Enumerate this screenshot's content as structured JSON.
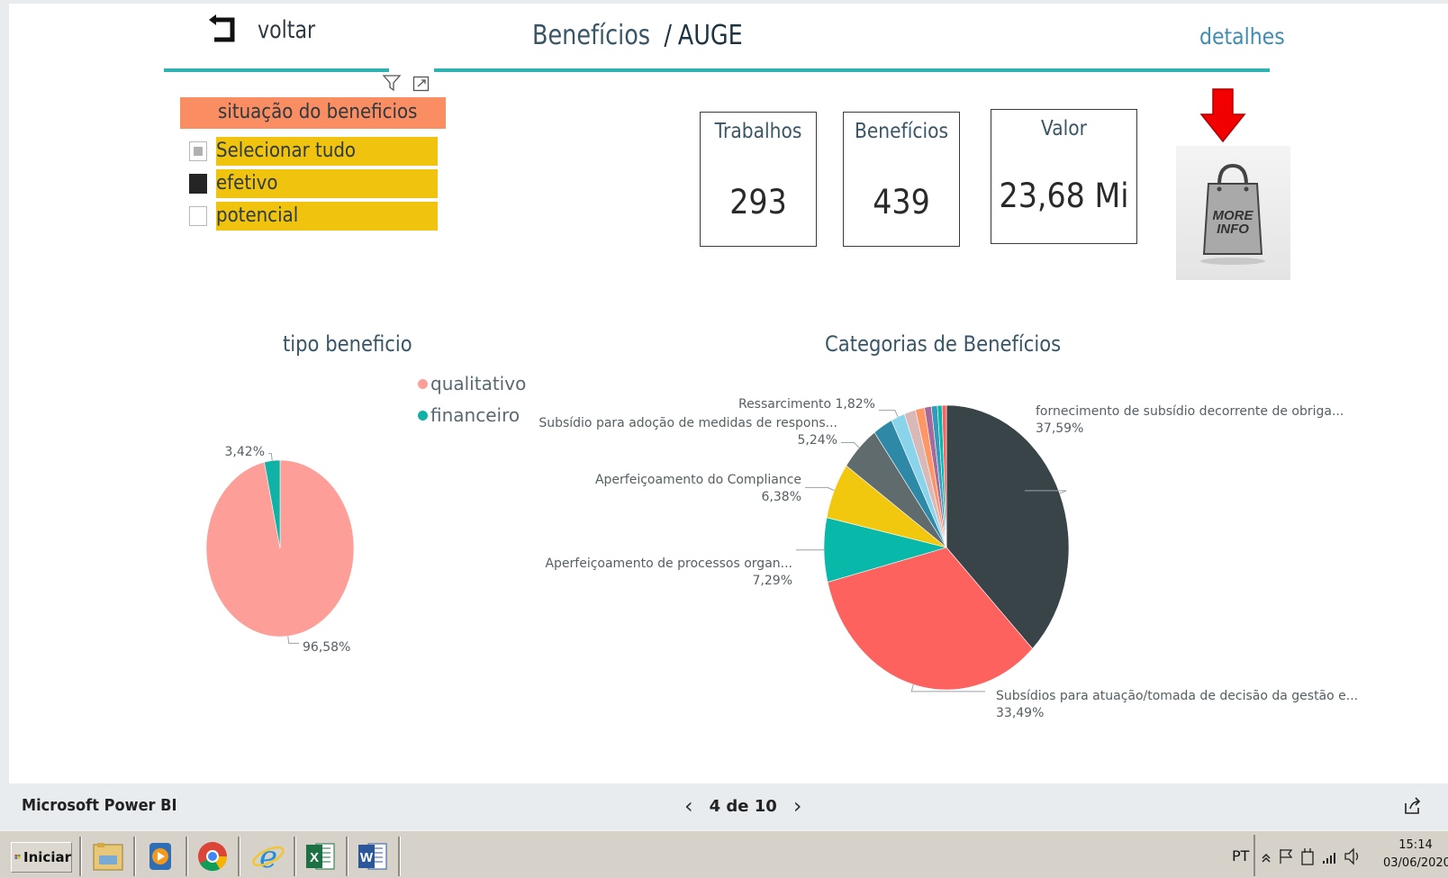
{
  "header": {
    "back_label": "voltar",
    "title": "Benefícios",
    "title_separator": "/",
    "subtitle": "AUGE",
    "details_link": "detalhes"
  },
  "slicer": {
    "title": "situação do beneficios",
    "items": [
      {
        "label": "Selecionar tudo",
        "state": "partial"
      },
      {
        "label": "efetivo",
        "state": "checked"
      },
      {
        "label": "potencial",
        "state": "unchecked"
      }
    ]
  },
  "kpis": {
    "trabalhos": {
      "label": "Trabalhos",
      "value": "293"
    },
    "beneficios": {
      "label": "Benefícios",
      "value": "439"
    },
    "valor": {
      "label": "Valor",
      "value": "23,68 Mi"
    }
  },
  "more_info": {
    "text_line1": "MORE",
    "text_line2": "INFO"
  },
  "chart_data": [
    {
      "type": "pie",
      "title": "tipo beneficio",
      "legend_position": "top-right",
      "slices": [
        {
          "label": "qualitativo",
          "value": 96.58,
          "data_label": "96,58%",
          "color": "#fd9f98"
        },
        {
          "label": "financeiro",
          "value": 3.42,
          "data_label": "3,42%",
          "color": "#10b2a5"
        }
      ]
    },
    {
      "type": "pie",
      "title": "Categorias de Benefícios",
      "slices": [
        {
          "label": "fornecimento de subsídio decorrente de obriga...",
          "value": 37.59,
          "data_label": "37,59%",
          "color": "#384448"
        },
        {
          "label": "Subsídios para atuação/tomada de decisão da gestão e...",
          "value": 33.49,
          "data_label": "33,49%",
          "color": "#fd625e"
        },
        {
          "label": "Aperfeiçoamento de processos organ...",
          "value": 7.29,
          "data_label": "7,29%",
          "color": "#08b8a8"
        },
        {
          "label": "Aperfeiçoamento do Compliance",
          "value": 6.38,
          "data_label": "6,38%",
          "color": "#f2c80f"
        },
        {
          "label": "Subsídio para adoção de medidas de respons...",
          "value": 5.24,
          "data_label": "5,24%",
          "color": "#5f6b6d"
        },
        {
          "label": "",
          "value": 2.6,
          "data_label": "",
          "color": "#2d89a6"
        },
        {
          "label": "Ressarcimento",
          "value": 1.82,
          "data_label": "1,82%",
          "color": "#8ad4eb"
        },
        {
          "label": "",
          "value": 1.5,
          "data_label": "",
          "color": "#d9b8b8"
        },
        {
          "label": "",
          "value": 1.2,
          "data_label": "",
          "color": "#fe9666"
        },
        {
          "label": "",
          "value": 0.9,
          "data_label": "",
          "color": "#a66999"
        },
        {
          "label": "",
          "value": 0.8,
          "data_label": "",
          "color": "#3599b8"
        },
        {
          "label": "",
          "value": 0.6,
          "data_label": "",
          "color": "#01b8aa"
        },
        {
          "label": "",
          "value": 0.58,
          "data_label": "",
          "color": "#fd625e"
        }
      ]
    }
  ],
  "footer": {
    "app_name": "Microsoft Power BI",
    "page_indicator": "4 de 10"
  },
  "taskbar": {
    "start_label": "Iniciar",
    "apps": [
      "file-explorer-icon",
      "media-player-icon",
      "chrome-icon",
      "internet-explorer-icon",
      "excel-icon",
      "word-icon"
    ],
    "language": "PT",
    "time": "15:14",
    "date": "03/06/2020"
  }
}
